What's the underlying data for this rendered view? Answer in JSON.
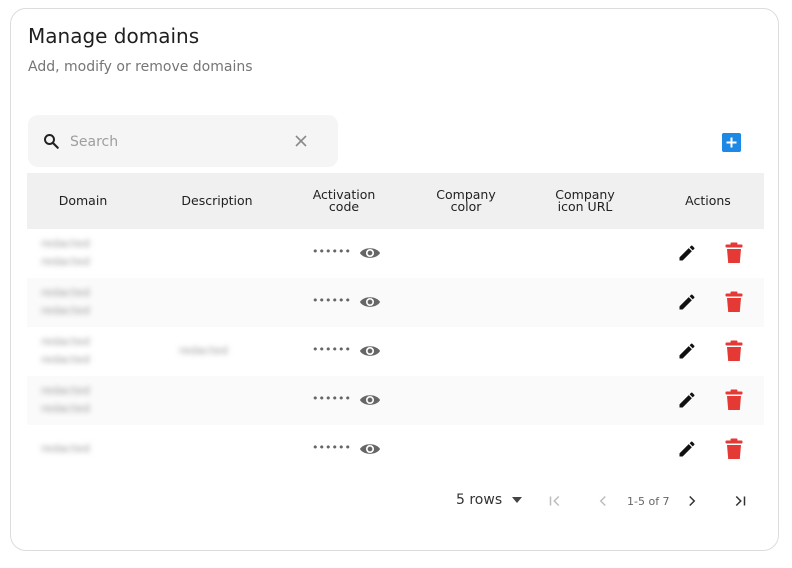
{
  "header": {
    "title": "Manage domains",
    "subtitle": "Add, modify or remove domains"
  },
  "search": {
    "placeholder": "Search",
    "value": ""
  },
  "icons": {
    "search": "search-icon",
    "clear": "close-icon",
    "add": "add-box-icon",
    "eye": "eye-icon",
    "edit": "pencil-icon",
    "delete": "trash-icon"
  },
  "colors": {
    "accent": "#1e88e5",
    "delete": "#e53935",
    "header_bg": "#f0f0f0"
  },
  "table": {
    "columns": {
      "domain": "Domain",
      "description": "Description",
      "activation_l1": "Activation",
      "activation_l2": "code",
      "color_l1": "Company",
      "color_l2": "color",
      "icon_l1": "Company",
      "icon_l2": "icon URL",
      "actions": "Actions"
    },
    "masked_code": "••••••",
    "rows": [
      {
        "domain_l1": "redacted",
        "domain_l2": "redacted",
        "description": ""
      },
      {
        "domain_l1": "redacted",
        "domain_l2": "redacted",
        "description": ""
      },
      {
        "domain_l1": "redacted",
        "domain_l2": "redacted",
        "description": "redacted"
      },
      {
        "domain_l1": "redacted",
        "domain_l2": "redacted",
        "description": ""
      },
      {
        "domain_l1": "redacted",
        "domain_l2": "",
        "description": ""
      }
    ]
  },
  "pagination": {
    "rows_label": "5 rows",
    "range": "1-5 of 7"
  }
}
